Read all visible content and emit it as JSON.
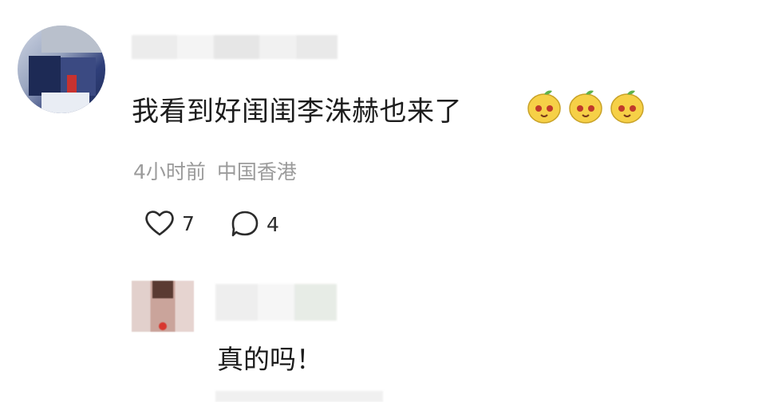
{
  "comment": {
    "text": "我看到好闺闺李洙赫也来了",
    "emoji_count": 3,
    "emoji_name": "lemon-face-emoji",
    "time": "4小时前",
    "location": "中国香港",
    "likes": "7",
    "replies": "4"
  },
  "reply": {
    "text": "真的吗！"
  },
  "colors": {
    "text": "#1c1c1c",
    "meta": "#9b9b9b",
    "icon": "#2b2b2b"
  }
}
